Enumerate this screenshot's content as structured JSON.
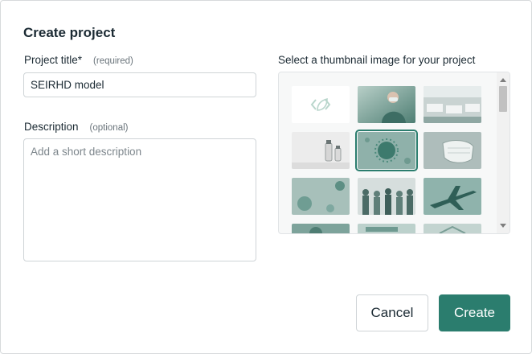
{
  "dialog": {
    "title": "Create project",
    "project_title": {
      "label": "Project title*",
      "hint": "(required)",
      "value": "SEIRHD model"
    },
    "description": {
      "label": "Description",
      "hint": "(optional)",
      "placeholder": "Add a short description",
      "value": ""
    },
    "thumbnails": {
      "label": "Select a thumbnail image for your project",
      "items": [
        {
          "name": "default-code-leaf-icon"
        },
        {
          "name": "doctor-with-mask"
        },
        {
          "name": "hospital-ward"
        },
        {
          "name": "vaccine-vials"
        },
        {
          "name": "virus-particle",
          "selected": true
        },
        {
          "name": "face-mask"
        },
        {
          "name": "virus-cluster"
        },
        {
          "name": "crowd-of-people"
        },
        {
          "name": "airplane"
        },
        {
          "name": "partial-1"
        },
        {
          "name": "partial-2"
        },
        {
          "name": "partial-3"
        }
      ]
    },
    "buttons": {
      "cancel": "Cancel",
      "create": "Create"
    }
  },
  "colors": {
    "accent": "#2b7d6e",
    "text": "#1b2a33",
    "muted": "#6a747b",
    "border": "#cfd4d7"
  }
}
